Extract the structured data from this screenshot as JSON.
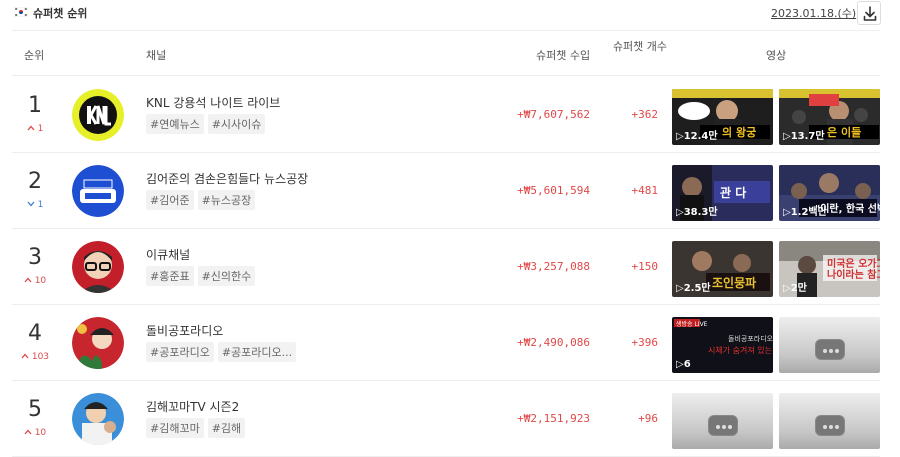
{
  "header": {
    "title": "슈퍼챗 순위",
    "date": "2023.01.18.(수)"
  },
  "columns": {
    "rank": "순위",
    "channel": "채널",
    "revenue": "슈퍼챗 수입",
    "count": "슈퍼챗 개수",
    "video": "영상"
  },
  "rows": [
    {
      "rank": "1",
      "change": "1",
      "direction": "up",
      "channel": "KNL 강용석 나이트 라이브",
      "tags": [
        "#연예뉴스",
        "#시사이슈"
      ],
      "revenue": "+₩7,607,562",
      "count": "+362",
      "videos": [
        {
          "views": "12.4만"
        },
        {
          "views": "13.7만"
        }
      ]
    },
    {
      "rank": "2",
      "change": "1",
      "direction": "down",
      "channel": "김어준의 겸손은힘들다 뉴스공장",
      "tags": [
        "#김어준",
        "#뉴스공장"
      ],
      "revenue": "+₩5,601,594",
      "count": "+481",
      "videos": [
        {
          "views": "38.3만"
        },
        {
          "views": "1.2백만"
        }
      ]
    },
    {
      "rank": "3",
      "change": "10",
      "direction": "up",
      "channel": "이큐채널",
      "tags": [
        "#홍준표",
        "#신의한수"
      ],
      "revenue": "+₩3,257,088",
      "count": "+150",
      "videos": [
        {
          "views": "2.5만"
        },
        {
          "views": "2만"
        }
      ]
    },
    {
      "rank": "4",
      "change": "103",
      "direction": "up",
      "channel": "돌비공포라디오",
      "tags": [
        "#공포라디오",
        "#공포라디오..."
      ],
      "revenue": "+₩2,490,086",
      "count": "+396",
      "videos": [
        {
          "views": "6"
        },
        {
          "views": ""
        }
      ]
    },
    {
      "rank": "5",
      "change": "10",
      "direction": "up",
      "channel": "김해꼬마TV 시즌2",
      "tags": [
        "#김해꼬마",
        "#김해"
      ],
      "revenue": "+₩2,151,923",
      "count": "+96",
      "videos": [
        {
          "views": ""
        },
        {
          "views": ""
        }
      ]
    }
  ],
  "icons": {
    "flag": "korea-flag-icon",
    "download": "download-icon",
    "up": "caret-up-icon",
    "down": "caret-down-icon",
    "play": "play-icon"
  },
  "colors": {
    "up": "#e04848",
    "down": "#3b7dd8",
    "revenue": "#e04848"
  }
}
